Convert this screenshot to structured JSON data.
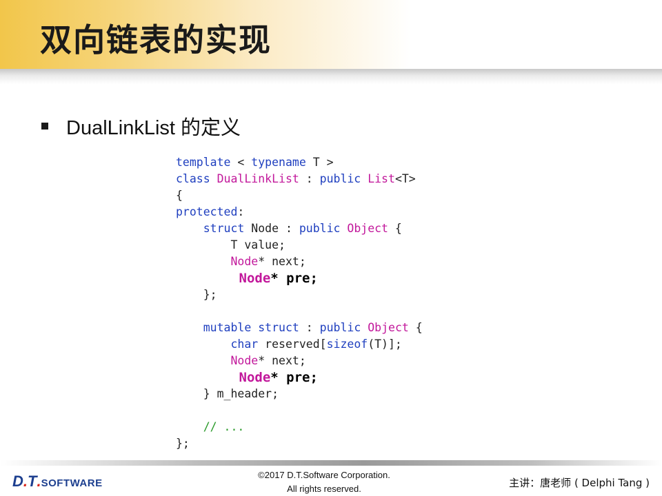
{
  "slide": {
    "title": "双向链表的实现",
    "bullet": "DualLinkList 的定义"
  },
  "code": {
    "l1_kw1": "template",
    "l1_p1": " < ",
    "l1_kw2": "typename",
    "l1_p2": " T >",
    "l2_kw1": "class",
    "l2_p1": " ",
    "l2_ty1": "DualLinkList",
    "l2_p2": " : ",
    "l2_kw2": "public",
    "l2_p3": " ",
    "l2_ty2": "List",
    "l2_p4": "<T>",
    "l3": "{",
    "l4_kw": "protected",
    "l4_p": ":",
    "l5_indent": "    ",
    "l5_kw1": "struct",
    "l5_p1": " Node : ",
    "l5_kw2": "public",
    "l5_p2": " ",
    "l5_ty": "Object",
    "l5_p3": " {",
    "l6": "        T value;",
    "l7_indent": "        ",
    "l7_ty": "Node",
    "l7_p": "* next;",
    "l8_indent": "    ",
    "l8_ty": "Node",
    "l8_p": "* pre;",
    "l9": "    };",
    "l10": "",
    "l11_indent": "    ",
    "l11_kw1": "mutable",
    "l11_p1": " ",
    "l11_kw2": "struct",
    "l11_p2": " : ",
    "l11_kw3": "public",
    "l11_p3": " ",
    "l11_ty": "Object",
    "l11_p4": " {",
    "l12_indent": "        ",
    "l12_kw1": "char",
    "l12_p1": " reserved[",
    "l12_kw2": "sizeof",
    "l12_p2": "(T)];",
    "l13_indent": "        ",
    "l13_ty": "Node",
    "l13_p": "* next;",
    "l14_indent": "    ",
    "l14_ty": "Node",
    "l14_p": "* pre;",
    "l15": "    } m_header;",
    "l16": "",
    "l17_indent": "    ",
    "l17_cm": "// ...",
    "l18": "};"
  },
  "footer": {
    "logo_d": "D",
    "logo_dot1": ".",
    "logo_t": "T",
    "logo_dot2": ".",
    "logo_software": "SOFTWARE",
    "copyright_line1": "©2017 D.T.Software Corporation.",
    "copyright_line2": "All rights reserved.",
    "presenter": "主讲：唐老师 ( Delphi Tang )"
  },
  "colors": {
    "title_band": "#f2c64a",
    "keyword": "#1f3fbf",
    "type": "#c2189b",
    "comment": "#2a9a2a",
    "logo_blue": "#1d3f8f",
    "logo_red": "#d9261c"
  }
}
